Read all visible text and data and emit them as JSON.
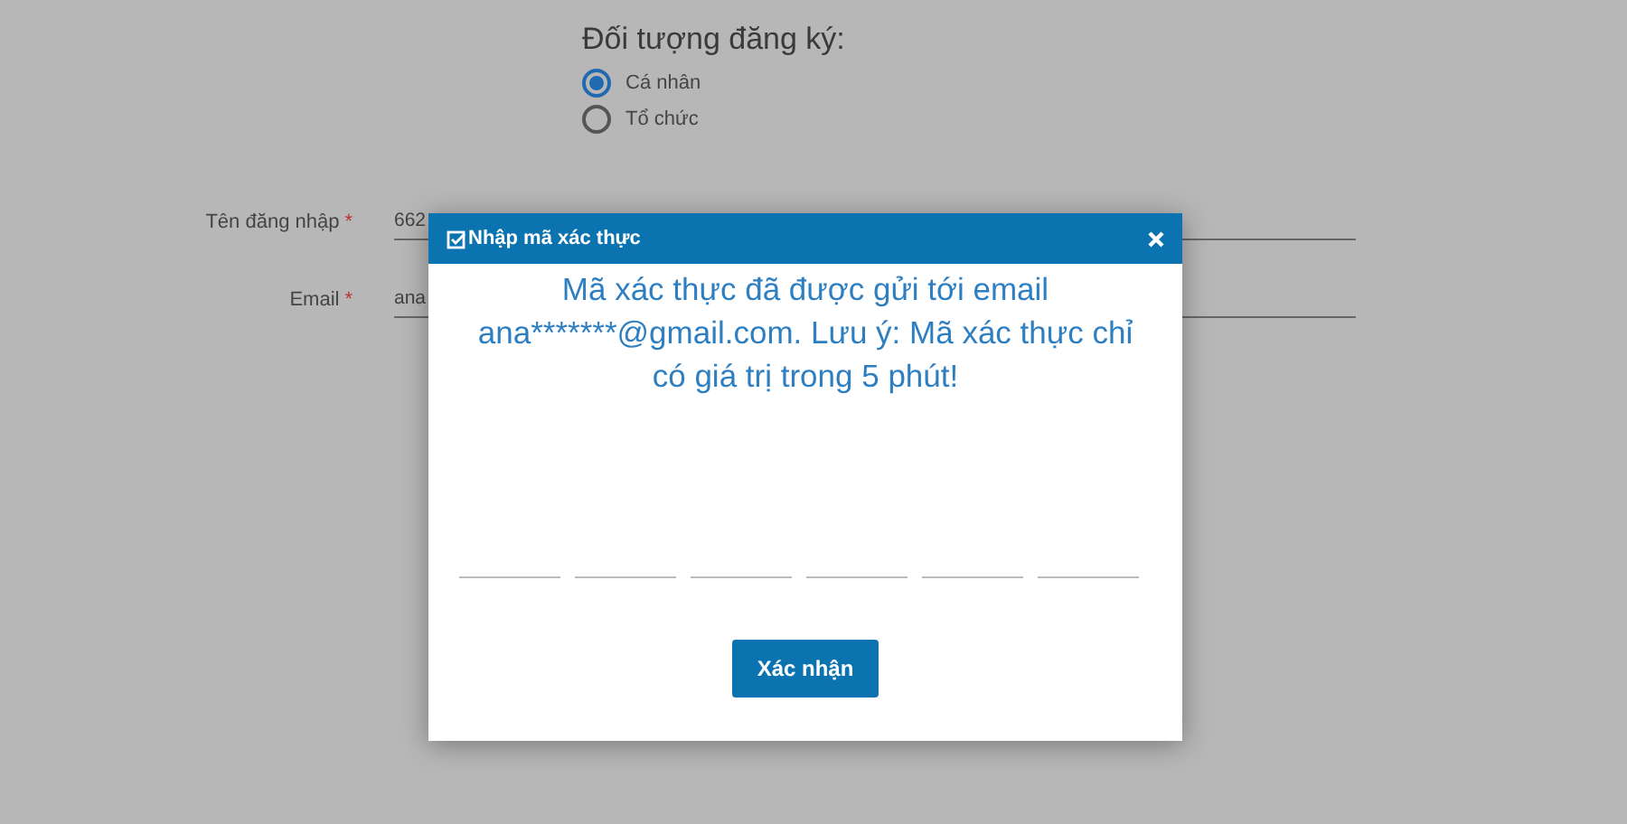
{
  "form": {
    "heading": "Đối tượng đăng ký:",
    "options": [
      {
        "label": "Cá nhân",
        "selected": true
      },
      {
        "label": "Tổ chức",
        "selected": false
      }
    ],
    "fields": [
      {
        "label": "Tên đăng nhập",
        "required_mark": "*",
        "value": "662"
      },
      {
        "label": "Email",
        "required_mark": "*",
        "value": "ana"
      }
    ]
  },
  "dialog": {
    "title": "Nhập mã xác thực",
    "message": "Mã xác thực đã được gửi tới email ana*******@gmail.com. Lưu ý: Mã xác thực chỉ có giá trị trong 5 phút!",
    "button": "Xác nhận"
  }
}
